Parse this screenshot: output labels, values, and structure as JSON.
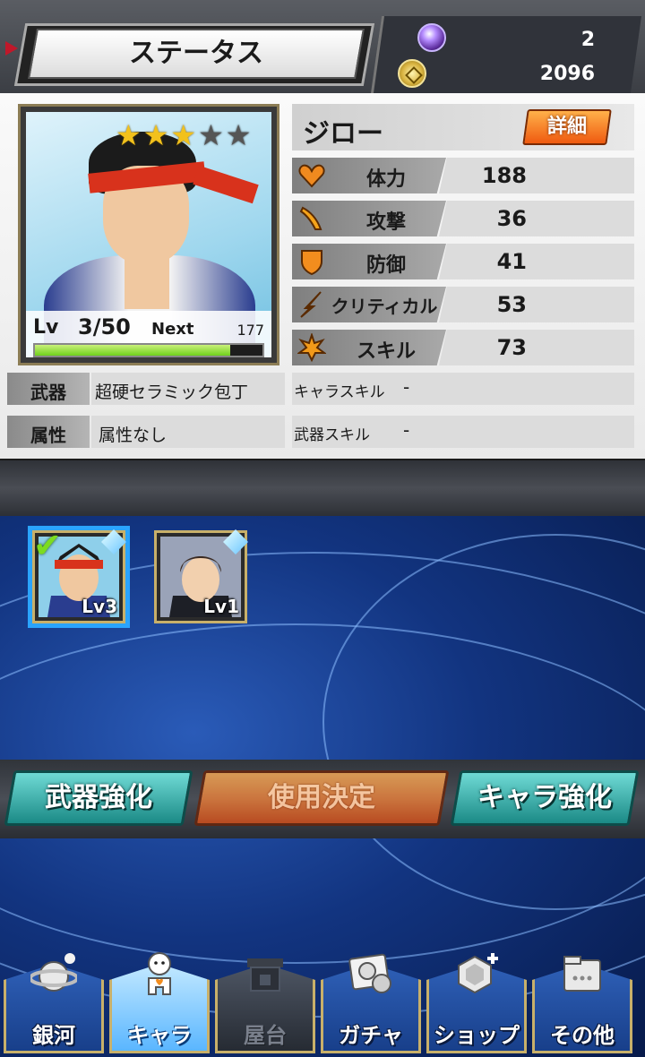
{
  "header": {
    "title": "ステータス",
    "gem_count": "2",
    "coin_count": "2096",
    "gem_icon": "gem-icon",
    "coin_icon": "coin-icon"
  },
  "character": {
    "name": "ジロー",
    "detail_button": "詳細",
    "rarity": {
      "stars_filled": 3,
      "stars_total": 5
    },
    "level_label": "Lv",
    "level": "3/50",
    "next_label": "Next",
    "next_value": "177",
    "exp_fraction": 0.86
  },
  "stats": [
    {
      "label": "体力",
      "value": "188",
      "icon": "heart-icon",
      "color": "#f08a1f"
    },
    {
      "label": "攻撃",
      "value": "36",
      "icon": "blade-icon",
      "color": "#f5a31a"
    },
    {
      "label": "防御",
      "value": "41",
      "icon": "shield-icon",
      "color": "#f28d1e"
    },
    {
      "label": "クリティカル",
      "value": "53",
      "icon": "critical-icon",
      "color": "#f5a31a"
    },
    {
      "label": "スキル",
      "value": "73",
      "icon": "burst-icon",
      "color": "#f29a1a"
    }
  ],
  "info": {
    "weapon_key": "武器",
    "weapon_value": "超硬セラミック包丁",
    "element_key": "属性",
    "element_value": "属性なし",
    "chara_skill_key": "キャラスキル",
    "chara_skill_value": "-",
    "weapon_skill_key": "武器スキル",
    "weapon_skill_value": "-"
  },
  "roster": [
    {
      "level": "Lv3",
      "selected": true
    },
    {
      "level": "Lv1",
      "selected": false
    }
  ],
  "actions": {
    "weapon_upgrade": "武器強化",
    "confirm_use": "使用決定",
    "chara_upgrade": "キャラ強化"
  },
  "nav": [
    {
      "label": "銀河",
      "icon": "planet-icon"
    },
    {
      "label": "キャラ",
      "icon": "character-icon"
    },
    {
      "label": "屋台",
      "icon": "stall-icon"
    },
    {
      "label": "ガチャ",
      "icon": "gacha-icon"
    },
    {
      "label": "ショップ",
      "icon": "shop-icon"
    },
    {
      "label": "その他",
      "icon": "folder-icon"
    }
  ],
  "colors": {
    "accent_orange": "#ef5a10",
    "accent_teal": "#1b8a86",
    "exp_green": "#6fcf1b",
    "selection_blue": "#2aa4ff"
  }
}
